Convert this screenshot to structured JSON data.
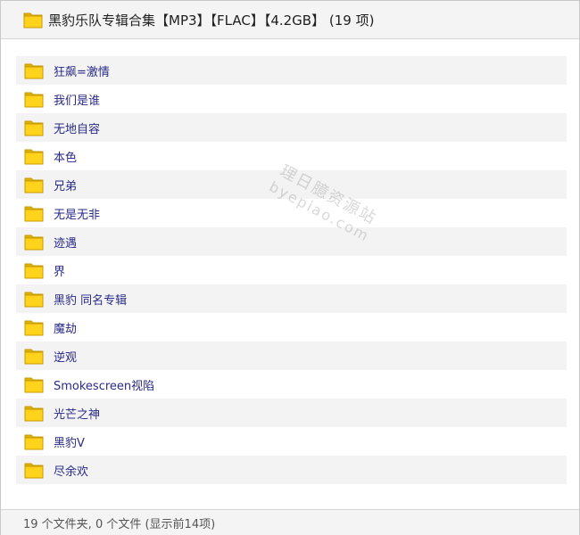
{
  "header": {
    "title": "黑豹乐队专辑合集【MP3】【FLAC】【4.2GB】 (19 项)",
    "icon": "folder-icon"
  },
  "folders": [
    {
      "label": "狂飙=激情"
    },
    {
      "label": "我们是谁"
    },
    {
      "label": "无地自容"
    },
    {
      "label": "本色"
    },
    {
      "label": "兄弟"
    },
    {
      "label": "无是无非"
    },
    {
      "label": "迹遇"
    },
    {
      "label": "界"
    },
    {
      "label": "黑豹 同名专辑"
    },
    {
      "label": "魔劫"
    },
    {
      "label": "逆观"
    },
    {
      "label": "Smokescreen视陷"
    },
    {
      "label": "光芒之神"
    },
    {
      "label": "黑豹V"
    },
    {
      "label": "尽余欢"
    }
  ],
  "footer": {
    "status": "19 个文件夹, 0 个文件 (显示前14项)"
  },
  "watermark": {
    "line1": "理日臆资源站",
    "line2": "byepiao.com"
  },
  "colors": {
    "folder_fill": "#ffd21c",
    "folder_edge": "#c99a00",
    "label_text": "#2a2a88",
    "stripe": "#f3f3f3"
  }
}
